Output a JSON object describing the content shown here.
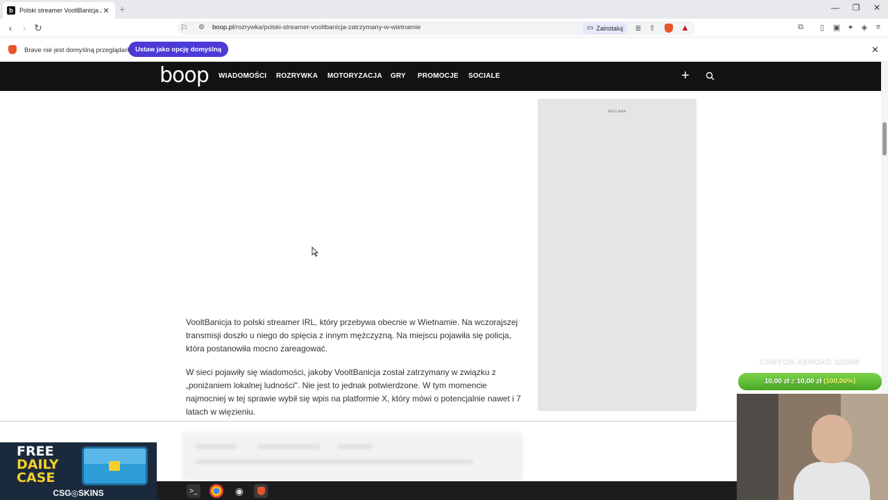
{
  "browser": {
    "tab_title": "Polski streamer VooltBanicja zatrzymany",
    "tab_favicon": "b",
    "url_domain": "boop.pl",
    "url_path": "/rozrywka/polski-streamer-vooltbanicja-zatrzymany-w-wietnamie",
    "install_label": "Zainstaluj",
    "info_text": "Brave nie jest domyślną przeglądarką",
    "set_default_label": "Ustaw jako opcję domyślną",
    "accent": "#4b3bd6"
  },
  "site": {
    "logo": "boop",
    "nav": [
      "WIADOMOŚCI",
      "ROZRYWKA",
      "MOTORYZACJA",
      "GRY",
      "PROMOCJE",
      "SOCIALE"
    ],
    "header_bg": "#121212"
  },
  "article": {
    "ad_label": "REKLAMA",
    "paragraphs": [
      "VooltBanicja to polski streamer IRL, który przebywa obecnie w Wietnamie. Na wczorajszej transmisji doszło u niego do spięcia z innym mężczyzną. Na miejscu pojawiła się policja, która postanowiła mocno zareagować.",
      "W sieci pojawiły się wiadomości, jakoby VooltBanicja został zatrzymany w związku z „poniżaniem lokalnej ludności\". Nie jest to jednak potwierdzone. W tym momencie najmocniej w tej sprawie wybił się wpis na platformie X, który mówi o potencjalnie nawet i 7 latach w więzieniu."
    ]
  },
  "overlay": {
    "promo_line1": "FREE",
    "promo_line2": "DAILY",
    "promo_line3": "CASE",
    "promo_brand": "CSG◎SKINS",
    "goal_title": "CANYON AEROAD 1/2000",
    "goal_current": "10,00 zł",
    "goal_sep": "z",
    "goal_target": "10,00 zł",
    "goal_percent": "(100,00%)"
  }
}
